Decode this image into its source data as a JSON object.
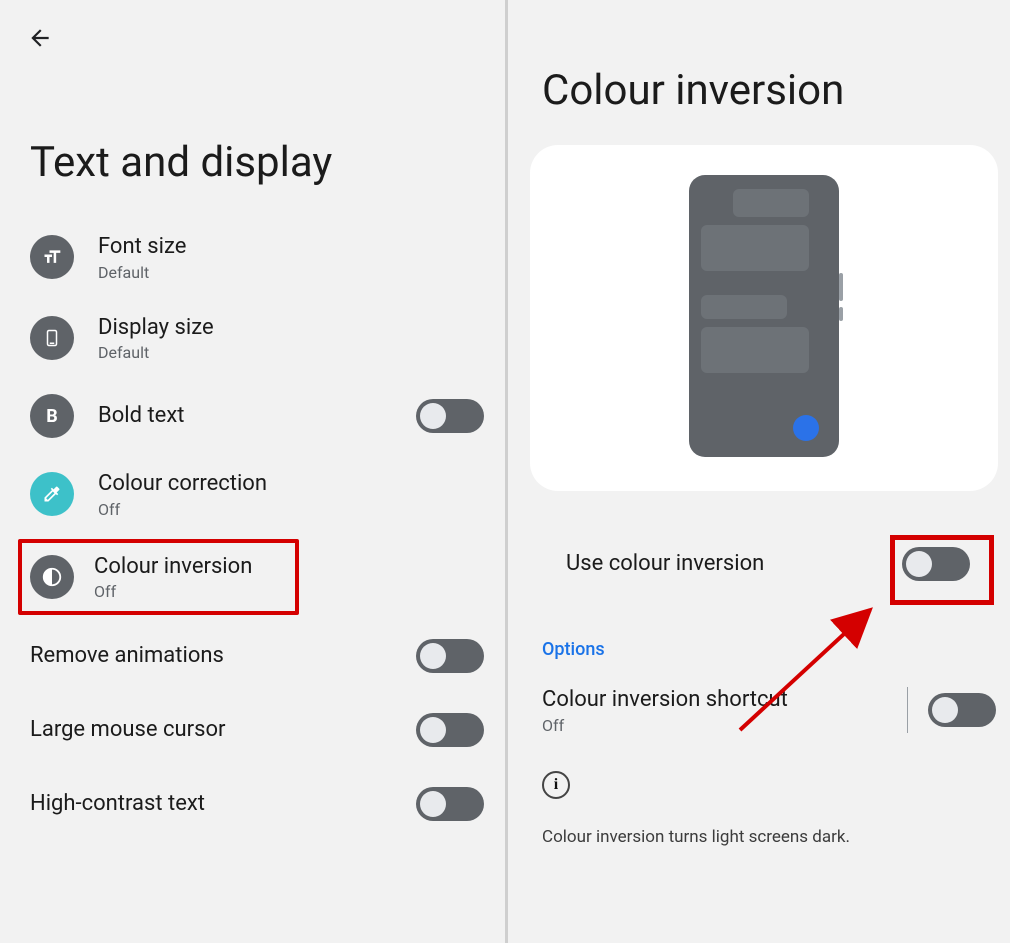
{
  "left": {
    "title": "Text and display",
    "items": [
      {
        "icon": "text-size-icon",
        "title": "Font size",
        "sub": "Default"
      },
      {
        "icon": "display-size-icon",
        "title": "Display size",
        "sub": "Default"
      },
      {
        "icon": "bold-icon",
        "title": "Bold text"
      },
      {
        "icon": "eyedropper-icon",
        "title": "Colour correction",
        "sub": "Off"
      },
      {
        "icon": "contrast-icon",
        "title": "Colour inversion",
        "sub": "Off"
      },
      {
        "title": "Remove animations"
      },
      {
        "title": "Large mouse cursor"
      },
      {
        "title": "High-contrast text"
      }
    ]
  },
  "right": {
    "title": "Colour inversion",
    "use_label": "Use colour inversion",
    "options_header": "Options",
    "shortcut_label": "Colour inversion shortcut",
    "shortcut_sub": "Off",
    "info_text": "Colour inversion turns light screens dark."
  }
}
